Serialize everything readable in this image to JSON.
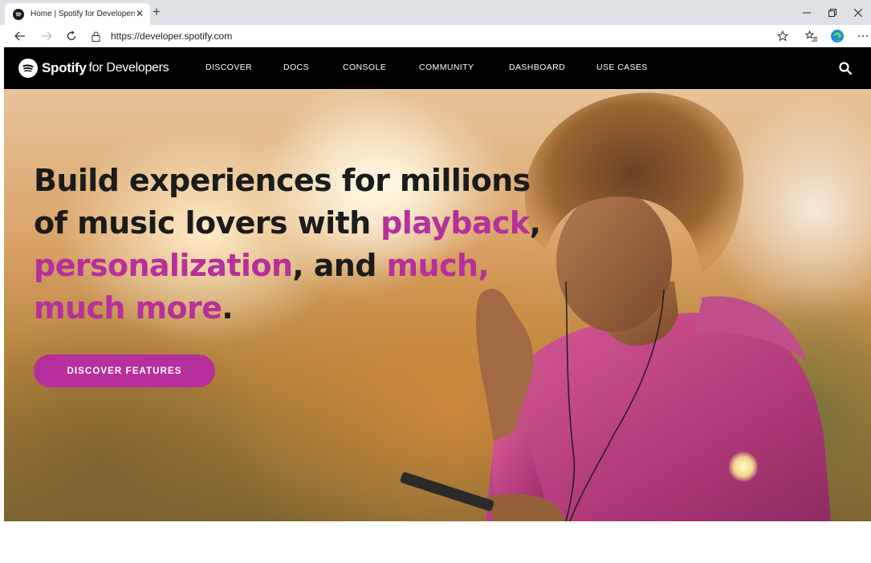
{
  "browser": {
    "tab_title": "Home | Spotify for Developers",
    "tab_close": "✕",
    "new_tab": "+",
    "url": "https://developer.spotify.com"
  },
  "header": {
    "logo_brand": "Spotify",
    "logo_suffix": "for Developers",
    "nav": [
      {
        "label": "DISCOVER"
      },
      {
        "label": "DOCS"
      },
      {
        "label": "CONSOLE"
      },
      {
        "label": "COMMUNITY"
      },
      {
        "label": "DASHBOARD"
      },
      {
        "label": "USE CASES"
      }
    ]
  },
  "hero": {
    "headline": {
      "part1": "Build experiences for millions of music lovers with ",
      "accent1": "playback",
      "part2": ", ",
      "accent2": "personalization",
      "part3": ", and ",
      "accent3": "much, much more",
      "part4": "."
    },
    "cta_label": "DISCOVER FEATURES"
  },
  "colors": {
    "accent": "#b72f9c",
    "header_bg": "#000000",
    "headline_text": "#1b1b1b"
  },
  "icons": {
    "back": "arrow-left-icon",
    "forward": "arrow-right-icon",
    "refresh": "refresh-icon",
    "lock": "lock-icon",
    "favorite": "star-icon",
    "favorites": "favorites-list-icon",
    "profile": "edge-profile-icon",
    "more": "more-dots-icon",
    "search": "search-icon"
  }
}
